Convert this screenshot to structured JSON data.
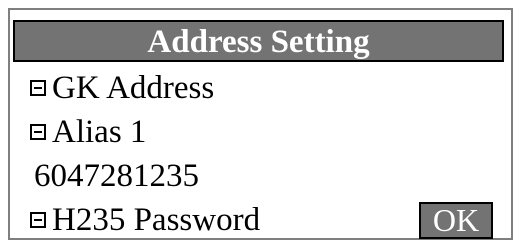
{
  "window": {
    "title": "Address Setting"
  },
  "items": [
    {
      "label": "GK Address",
      "icon": "collapse-box-icon"
    },
    {
      "label": "Alias 1",
      "icon": "collapse-box-icon"
    },
    {
      "label": "6047281235"
    },
    {
      "label": "H235 Password",
      "icon": "collapse-box-icon"
    }
  ],
  "actions": {
    "ok_label": "OK"
  },
  "colors": {
    "title_background": "#737373",
    "title_text": "#ffffff",
    "panel_border": "#7f7f7f",
    "text": "#000000"
  }
}
